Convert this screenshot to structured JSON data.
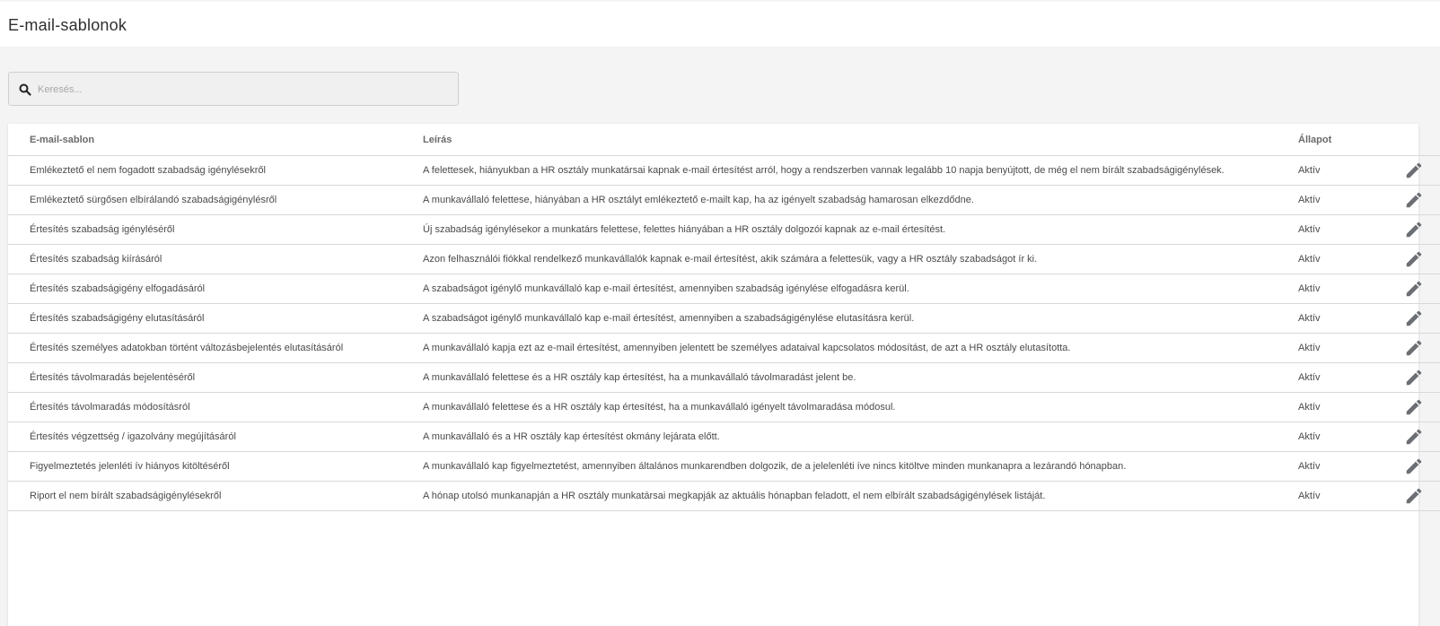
{
  "page": {
    "title": "E-mail-sablonok"
  },
  "search": {
    "placeholder": "Keresés...",
    "value": "",
    "icon": "search-icon"
  },
  "table": {
    "headers": {
      "template": "E-mail-sablon",
      "description": "Leírás",
      "status": "Állapot"
    },
    "rows": [
      {
        "template": "Emlékeztető el nem fogadott szabadság igénylésekről",
        "description": "A felettesek, hiányukban a HR osztály munkatársai kapnak e-mail értesítést arról, hogy a rendszerben vannak legalább 10 napja benyújtott, de még el nem bírált szabadságigénylések.",
        "status": "Aktív"
      },
      {
        "template": "Emlékeztető sürgősen elbírálandó szabadságigénylésről",
        "description": "A munkavállaló felettese, hiányában a HR osztályt emlékeztető e-mailt kap, ha az igényelt szabadság hamarosan elkezdődne.",
        "status": "Aktív"
      },
      {
        "template": "Értesítés szabadság igényléséről",
        "description": "Új szabadság igénylésekor a munkatárs felettese, felettes hiányában a HR osztály dolgozói kapnak az e-mail értesítést.",
        "status": "Aktív"
      },
      {
        "template": "Értesítés szabadság kiírásáról",
        "description": "Azon felhasználói fiókkal rendelkező munkavállalók kapnak e-mail értesítést, akik számára a felettesük, vagy a HR osztály szabadságot ír ki.",
        "status": "Aktív"
      },
      {
        "template": "Értesítés szabadságigény elfogadásáról",
        "description": "A szabadságot igénylő munkavállaló kap e-mail értesítést, amennyiben szabadság igénylése elfogadásra kerül.",
        "status": "Aktív"
      },
      {
        "template": "Értesítés szabadságigény elutasításáról",
        "description": "A szabadságot igénylő munkavállaló kap e-mail értesítést, amennyiben a szabadságigénylése elutasításra kerül.",
        "status": "Aktív"
      },
      {
        "template": "Értesítés személyes adatokban történt változásbejelentés elutasításáról",
        "description": "A munkavállaló kapja ezt az e-mail értesítést, amennyiben jelentett be személyes adataival kapcsolatos módosítást, de azt a HR osztály elutasította.",
        "status": "Aktív"
      },
      {
        "template": "Értesítés távolmaradás bejelentéséről",
        "description": "A munkavállaló felettese és a HR osztály kap értesítést, ha a munkavállaló távolmaradást jelent be.",
        "status": "Aktív"
      },
      {
        "template": "Értesítés távolmaradás módosításról",
        "description": "A munkavállaló felettese és a HR osztály kap értesítést, ha a munkavállaló igényelt távolmaradása módosul.",
        "status": "Aktív"
      },
      {
        "template": "Értesítés végzettség / igazolvány megújításáról",
        "description": "A munkavállaló és a HR osztály kap értesítést okmány lejárata előtt.",
        "status": "Aktív"
      },
      {
        "template": "Figyelmeztetés jelenléti ív hiányos kitöltéséről",
        "description": "A munkavállaló kap figyelmeztetést, amennyiben általános munkarendben dolgozik, de a jelelenléti íve nincs kitöltve minden munkanapra a lezárandó hónapban.",
        "status": "Aktív"
      },
      {
        "template": "Riport el nem bírált szabadságigénylésekről",
        "description": "A hónap utolsó munkanapján a HR osztály munkatársai megkapják az aktuális hónapban feladott, el nem elbírált szabadságigénylések listáját.",
        "status": "Aktív"
      }
    ],
    "row_action_icon": "pencil-icon"
  },
  "colors": {
    "background": "#f4f4f5",
    "card": "#ffffff",
    "icon": "#6b6f73"
  }
}
